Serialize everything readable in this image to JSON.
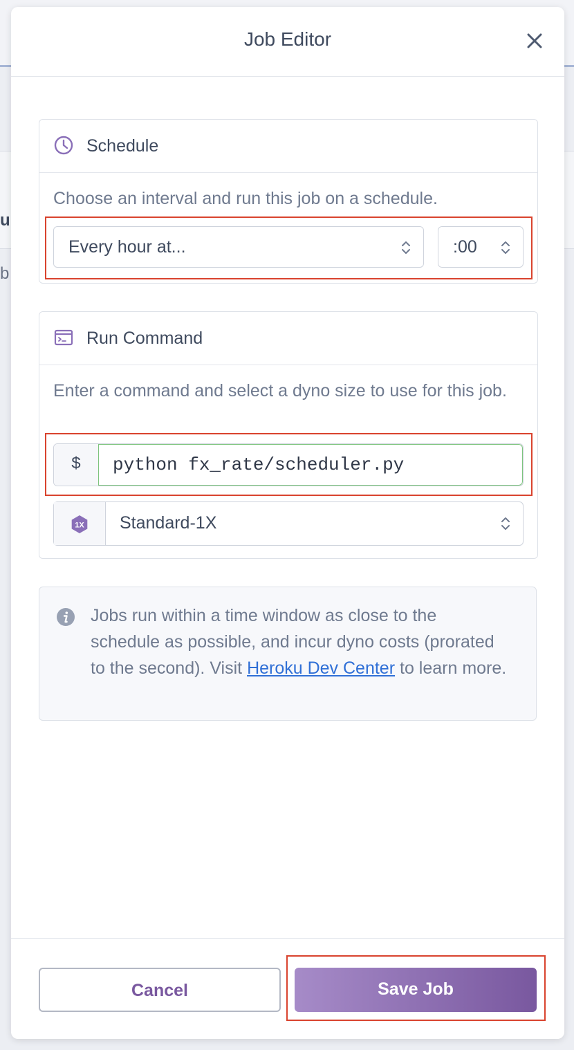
{
  "modal": {
    "title": "Job Editor"
  },
  "schedule": {
    "heading": "Schedule",
    "description": "Choose an interval and run this job on a schedule.",
    "interval_value": "Every hour at...",
    "minute_value": ":00"
  },
  "run_command": {
    "heading": "Run Command",
    "description": "Enter a command and select a dyno size to use for this job.",
    "prompt_symbol": "$",
    "command_value": "python fx_rate/scheduler.py",
    "dyno_badge": "1X",
    "dyno_value": "Standard-1X"
  },
  "info": {
    "text_before_link": "Jobs run within a time window as close to the schedule as possible, and incur dyno costs (prorated to the second). Visit ",
    "link_text": "Heroku Dev Center",
    "text_after_link": " to learn more."
  },
  "footer": {
    "cancel_label": "Cancel",
    "save_label": "Save Job"
  },
  "background": {
    "letter_u": "u",
    "letter_b": "b"
  },
  "colors": {
    "accent_purple": "#79589f",
    "link_blue": "#2f6fd6",
    "highlight_red": "#d9432e",
    "valid_green": "#7ec47e"
  }
}
